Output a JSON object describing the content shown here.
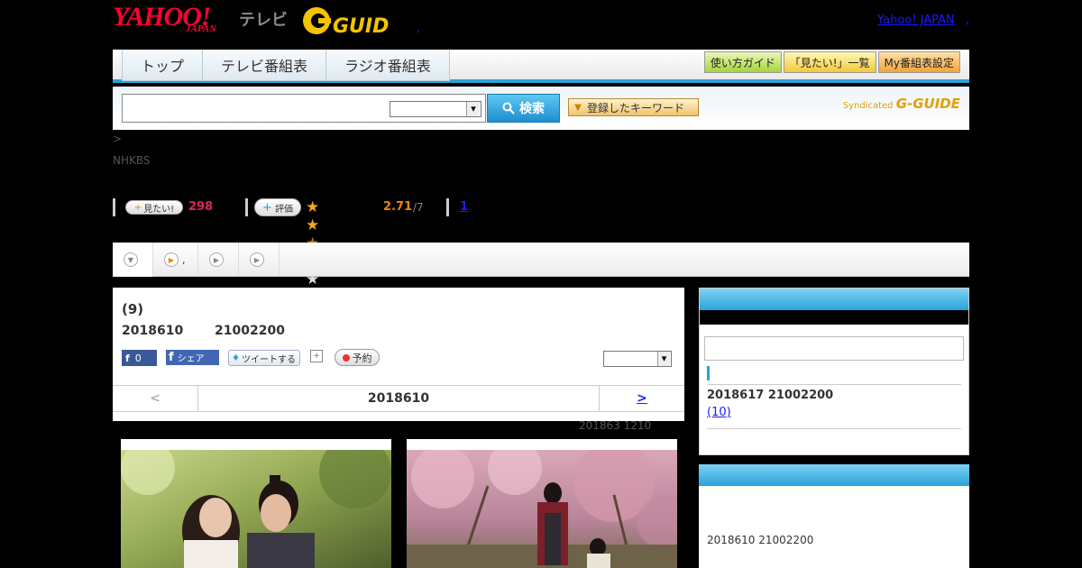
{
  "header": {
    "yahoo_logo": "YAHOO!",
    "japan_logo": "JAPAN",
    "tv_label": "テレビ",
    "yahoo_japan_link": "Yahoo! JAPAN",
    "link_separator": ",",
    "dot": ","
  },
  "nav": {
    "tabs": [
      {
        "label": "トップ"
      },
      {
        "label": "テレビ番組表"
      },
      {
        "label": "ラジオ番組表"
      }
    ],
    "buttons": [
      {
        "label": "使い方ガイド"
      },
      {
        "label": "「見たい!」一覧"
      },
      {
        "label": "My番組表設定"
      }
    ]
  },
  "search": {
    "input_value": "",
    "select_value": "",
    "button_label": "検索",
    "keyword_button_label": "登録したキーワード",
    "syndicated_label": "Syndicated",
    "syndicated_brand": "G-GUIDE"
  },
  "breadcrumb": ">",
  "channel": "NHKBS",
  "stats": {
    "mitai_label": "見たい!",
    "mitai_count": "298",
    "hyoka_label": "評価",
    "rating_value": 2.71,
    "rating_text": "2.71",
    "rating_of": "/7",
    "review_count": "1"
  },
  "tabs": [
    {
      "label": ""
    },
    {
      "label": ","
    },
    {
      "label": ""
    },
    {
      "label": ""
    }
  ],
  "program": {
    "title": "(9)",
    "date": "2018610",
    "time": "21002200",
    "fb_like_count": "0",
    "fb_share_label": "シェア",
    "tweet_label": "ツイートする",
    "reserve_label": "予約",
    "select_value": "",
    "pager_prev": "<",
    "pager_date": "2018610",
    "pager_next": ">",
    "next_air": "201863  1210"
  },
  "sidebar": {
    "next_time": "2018617  21002200",
    "next_episode": "(10)",
    "second_time": "2018610  21002200"
  },
  "colors": {
    "accent_blue": "#2aa3d8",
    "yahoo_red": "#ff0033",
    "mitai_pink": "#e0245e",
    "rating_orange": "#e58a00"
  }
}
